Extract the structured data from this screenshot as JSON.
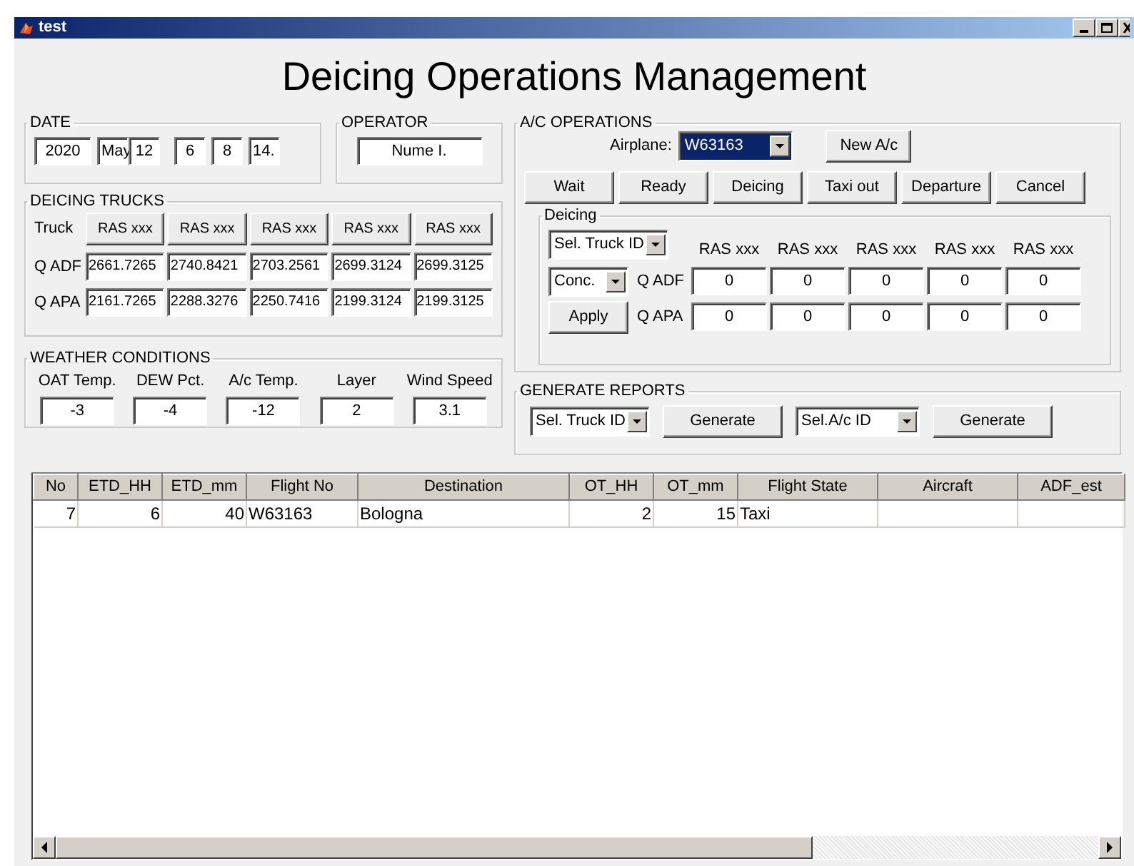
{
  "window": {
    "title": "test"
  },
  "heading": "Deicing Operations Management",
  "date": {
    "label": "DATE",
    "fields": [
      "2020",
      "May",
      "12",
      "6",
      "8",
      "14."
    ]
  },
  "operator": {
    "label": "OPERATOR",
    "value": "Nume I."
  },
  "deicing_trucks": {
    "label": "DEICING TRUCKS",
    "row_labels": [
      "Truck",
      "Q ADF",
      "Q APA"
    ],
    "trucks": [
      "RAS xxx",
      "RAS xxx",
      "RAS xxx",
      "RAS xxx",
      "RAS xxx"
    ],
    "q_adf": [
      "2661.7265",
      "2740.8421",
      "2703.2561",
      "2699.3124",
      "2699.3125"
    ],
    "q_apa": [
      "2161.7265",
      "2288.3276",
      "2250.7416",
      "2199.3124",
      "2199.3125"
    ]
  },
  "weather": {
    "label": "WEATHER CONDITIONS",
    "items": [
      {
        "label": "OAT Temp.",
        "value": "-3"
      },
      {
        "label": "DEW Pct.",
        "value": "-4"
      },
      {
        "label": "A/c Temp.",
        "value": "-12"
      },
      {
        "label": "Layer",
        "value": "2"
      },
      {
        "label": "Wind Speed",
        "value": "3.1"
      }
    ]
  },
  "ac_operations": {
    "label": "A/C OPERATIONS",
    "airplane_label": "Airplane:",
    "airplane": {
      "value": "W63163",
      "highlighted": true
    },
    "new_button": "New A/c",
    "state_buttons": [
      "Wait",
      "Ready",
      "Deicing",
      "Taxi out",
      "Departure",
      "Cancel"
    ],
    "deicing": {
      "label": "Deicing",
      "truck_select": "Sel. Truck ID",
      "conc_select": "Conc.",
      "apply": "Apply",
      "columns": [
        "RAS xxx",
        "RAS xxx",
        "RAS xxx",
        "RAS xxx",
        "RAS xxx"
      ],
      "rows": [
        {
          "label": "Q ADF",
          "values": [
            "0",
            "0",
            "0",
            "0",
            "0"
          ]
        },
        {
          "label": "Q APA",
          "values": [
            "0",
            "0",
            "0",
            "0",
            "0"
          ]
        }
      ]
    }
  },
  "generate_reports": {
    "label": "GENERATE REPORTS",
    "truck_select": "Sel. Truck ID",
    "truck_button": "Generate",
    "ac_select": "Sel.A/c ID",
    "ac_button": "Generate"
  },
  "table": {
    "columns": [
      {
        "label": "No",
        "kind": "number"
      },
      {
        "label": "ETD_HH",
        "kind": "number"
      },
      {
        "label": "ETD_mm",
        "kind": "number"
      },
      {
        "label": "Flight No",
        "kind": "text"
      },
      {
        "label": "Destination",
        "kind": "text"
      },
      {
        "label": "OT_HH",
        "kind": "number"
      },
      {
        "label": "OT_mm",
        "kind": "number"
      },
      {
        "label": "Flight State",
        "kind": "text"
      },
      {
        "label": "Aircraft",
        "kind": "text"
      },
      {
        "label": "ADF_est",
        "kind": "text"
      }
    ],
    "rows": [
      [
        "7",
        "6",
        "40",
        "W63163",
        "Bologna",
        "2",
        "15",
        "Taxi",
        "",
        ""
      ]
    ]
  }
}
